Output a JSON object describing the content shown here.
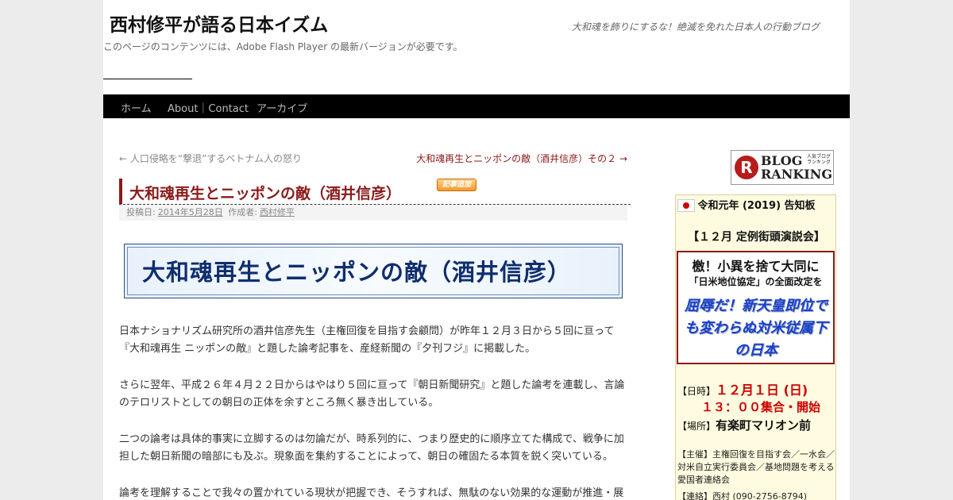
{
  "header": {
    "site_title": "西村修平が語る日本イズム",
    "site_description": "大和魂を飾りにするな！絶滅を免れた日本人の行動ブログ",
    "flash_notice": "このページのコンテンツには、Adobe Flash Player の最新バージョンが必要です。"
  },
  "nav": {
    "items": [
      {
        "label": "ホーム"
      },
      {
        "label": "About｜Contact"
      },
      {
        "label": "アーカイブ"
      }
    ]
  },
  "post_nav": {
    "prev": "← 人口侵略を“撃退”するベトナム人の怒り",
    "next": "大和魂再生とニッポンの敵（酒井信彦）その２ →"
  },
  "post": {
    "title": "大和魂再生とニッポンの敵（酒井信彦）",
    "badge": "記事追加",
    "meta_posted": "投稿日:",
    "meta_date": "2014年5月28日",
    "meta_author_label": "作成者:",
    "meta_author": "西村修平",
    "banner_text": "大和魂再生とニッポンの敵（酒井信彦）",
    "paragraphs": [
      "日本ナショナリズム研究所の酒井信彦先生（主権回復を目指す会顧問）が昨年１２月３日から５回に亘って『大和魂再生 ニッポンの敵』と題した論考記事を、産経新聞の『夕刊フジ』に掲載した。",
      "さらに翌年、平成２６年４月２２日からはやはり５回に亘って『朝日新聞研究』と題した論考を連載し、言論のテロリストとしての朝日の正体を余すところ無く暴き出している。",
      "二つの論考は具体的事実に立脚するのは勿論だが、時系列的に、つまり歴史的に順序立てた構成で、戦争に加担した朝日新聞の暗部にも及ぶ。現象面を集約することによって、朝日の確固たる本質を鋭く突いている。",
      "論考を理解することで我々の置かれている現状が把握でき、そうすれば、無駄のない効果的な運動が推進・展"
    ]
  },
  "sidebar": {
    "ranking": {
      "letter": "R",
      "line1": "BLOG",
      "line2": "RANKING",
      "small": "人気ブログランキング"
    },
    "notice": {
      "title": "令和元年 (2019) 告知板",
      "subtitle": "【１２月 定例街頭演説会】",
      "box_line1": "檄！小異を捨て大同に",
      "box_line2": "「日米地位協定」の全面改定を",
      "box_line3": "屈辱だ！新天皇即位でも変わらぬ対米従属下の日本",
      "date_label": "【日時】",
      "date_value": "１２月１日 (日)",
      "time_value": "１３：００集合・開始",
      "place_label": "【場所】",
      "place_value": "有楽町マリオン前",
      "organizers": "【主催】主権回復を目指す会／一水会／対米自立実行委員会／基地問題を考える愛国者連絡会",
      "contact": "【連絡】西村 (090-2756-8794)"
    }
  }
}
